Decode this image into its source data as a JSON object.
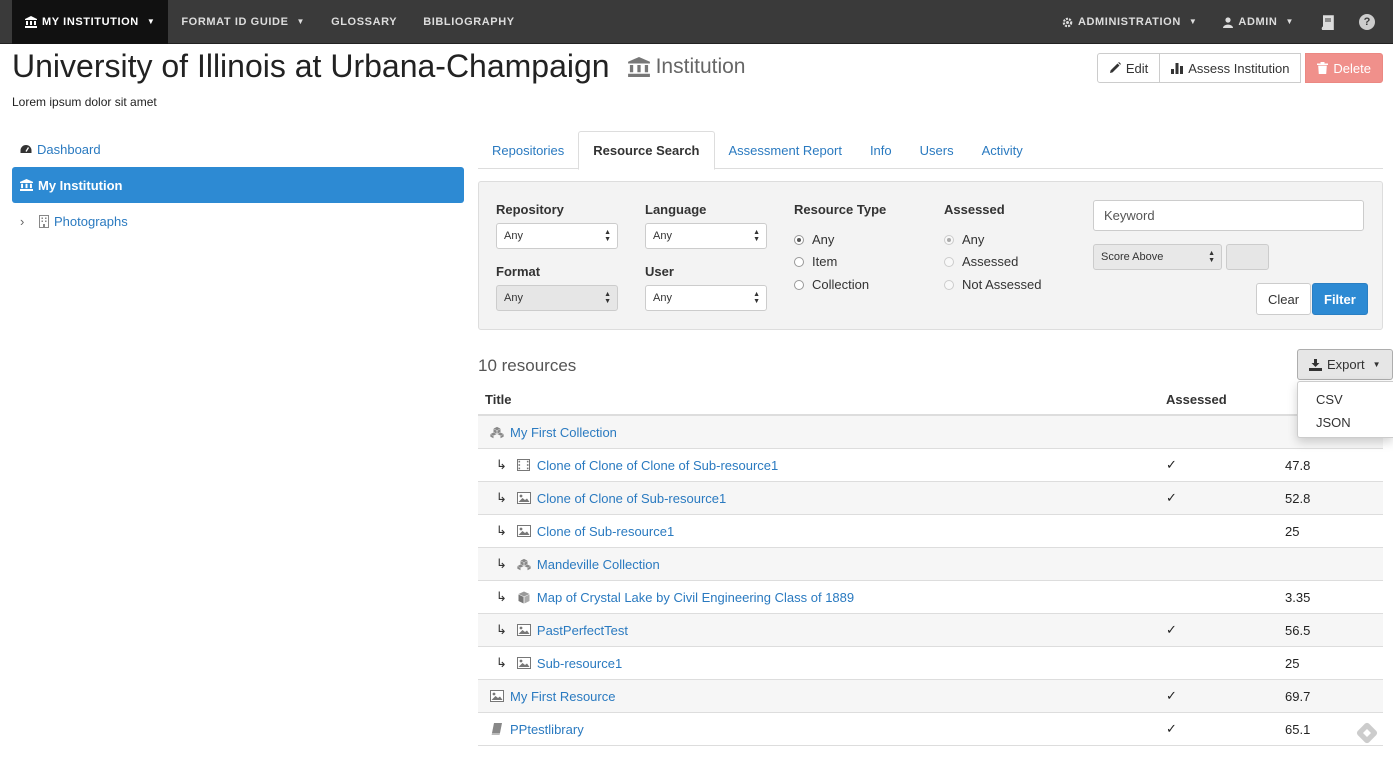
{
  "navbar": {
    "my_institution": "MY INSTITUTION",
    "format_id_guide": "FORMAT ID GUIDE",
    "glossary": "GLOSSARY",
    "bibliography": "BIBLIOGRAPHY",
    "administration": "ADMINISTRATION",
    "admin": "ADMIN",
    "help": "?"
  },
  "header": {
    "title": "University of Illinois at Urbana-Champaign",
    "type_label": "Institution",
    "description": "Lorem ipsum dolor sit amet",
    "edit_label": "Edit",
    "assess_label": "Assess Institution",
    "delete_label": "Delete"
  },
  "sidebar": {
    "items": [
      {
        "label": "Dashboard"
      },
      {
        "label": "My Institution"
      },
      {
        "label": "Photographs"
      }
    ]
  },
  "tabs": [
    {
      "label": "Repositories"
    },
    {
      "label": "Resource Search"
    },
    {
      "label": "Assessment Report"
    },
    {
      "label": "Info"
    },
    {
      "label": "Users"
    },
    {
      "label": "Activity"
    }
  ],
  "filters": {
    "repository_label": "Repository",
    "repository_value": "Any",
    "language_label": "Language",
    "language_value": "Any",
    "format_label": "Format",
    "format_value": "Any",
    "user_label": "User",
    "user_value": "Any",
    "resource_type_label": "Resource Type",
    "resource_type_options": [
      "Any",
      "Item",
      "Collection"
    ],
    "assessed_label": "Assessed",
    "assessed_options": [
      "Any",
      "Assessed",
      "Not Assessed"
    ],
    "keyword_placeholder": "Keyword",
    "score_select": "Score Above",
    "clear_label": "Clear",
    "filter_label": "Filter"
  },
  "results": {
    "count": "10 resources",
    "export_label": "Export",
    "export_options": [
      "CSV",
      "JSON"
    ],
    "columns": {
      "title": "Title",
      "assessed": "Assessed"
    },
    "rows": [
      {
        "title": "My First Collection",
        "icon": "collection-icon",
        "child": false,
        "assessed": "",
        "score": ""
      },
      {
        "title": "Clone of Clone of Clone of Sub-resource1",
        "icon": "film-icon",
        "child": true,
        "assessed": "✓",
        "score": "47.8"
      },
      {
        "title": "Clone of Clone of Sub-resource1",
        "icon": "image-icon",
        "child": true,
        "assessed": "✓",
        "score": "52.8"
      },
      {
        "title": "Clone of Sub-resource1",
        "icon": "image-icon",
        "child": true,
        "assessed": "",
        "score": "25"
      },
      {
        "title": "Mandeville Collection",
        "icon": "collection-icon",
        "child": true,
        "assessed": "",
        "score": ""
      },
      {
        "title": "Map of Crystal Lake by Civil Engineering Class of 1889",
        "icon": "cube-icon",
        "child": true,
        "assessed": "",
        "score": "3.35"
      },
      {
        "title": "PastPerfectTest",
        "icon": "image-icon",
        "child": true,
        "assessed": "✓",
        "score": "56.5"
      },
      {
        "title": "Sub-resource1",
        "icon": "image-icon",
        "child": true,
        "assessed": "",
        "score": "25"
      },
      {
        "title": "My First Resource",
        "icon": "image-icon",
        "child": false,
        "assessed": "✓",
        "score": "69.7"
      },
      {
        "title": "PPtestlibrary",
        "icon": "book-icon",
        "child": false,
        "assessed": "✓",
        "score": "65.1"
      }
    ]
  },
  "colors": {
    "accent": "#2d8ad3",
    "link": "#2a7ac0",
    "danger": "#f0908b",
    "navbar": "#3a3a3a"
  }
}
